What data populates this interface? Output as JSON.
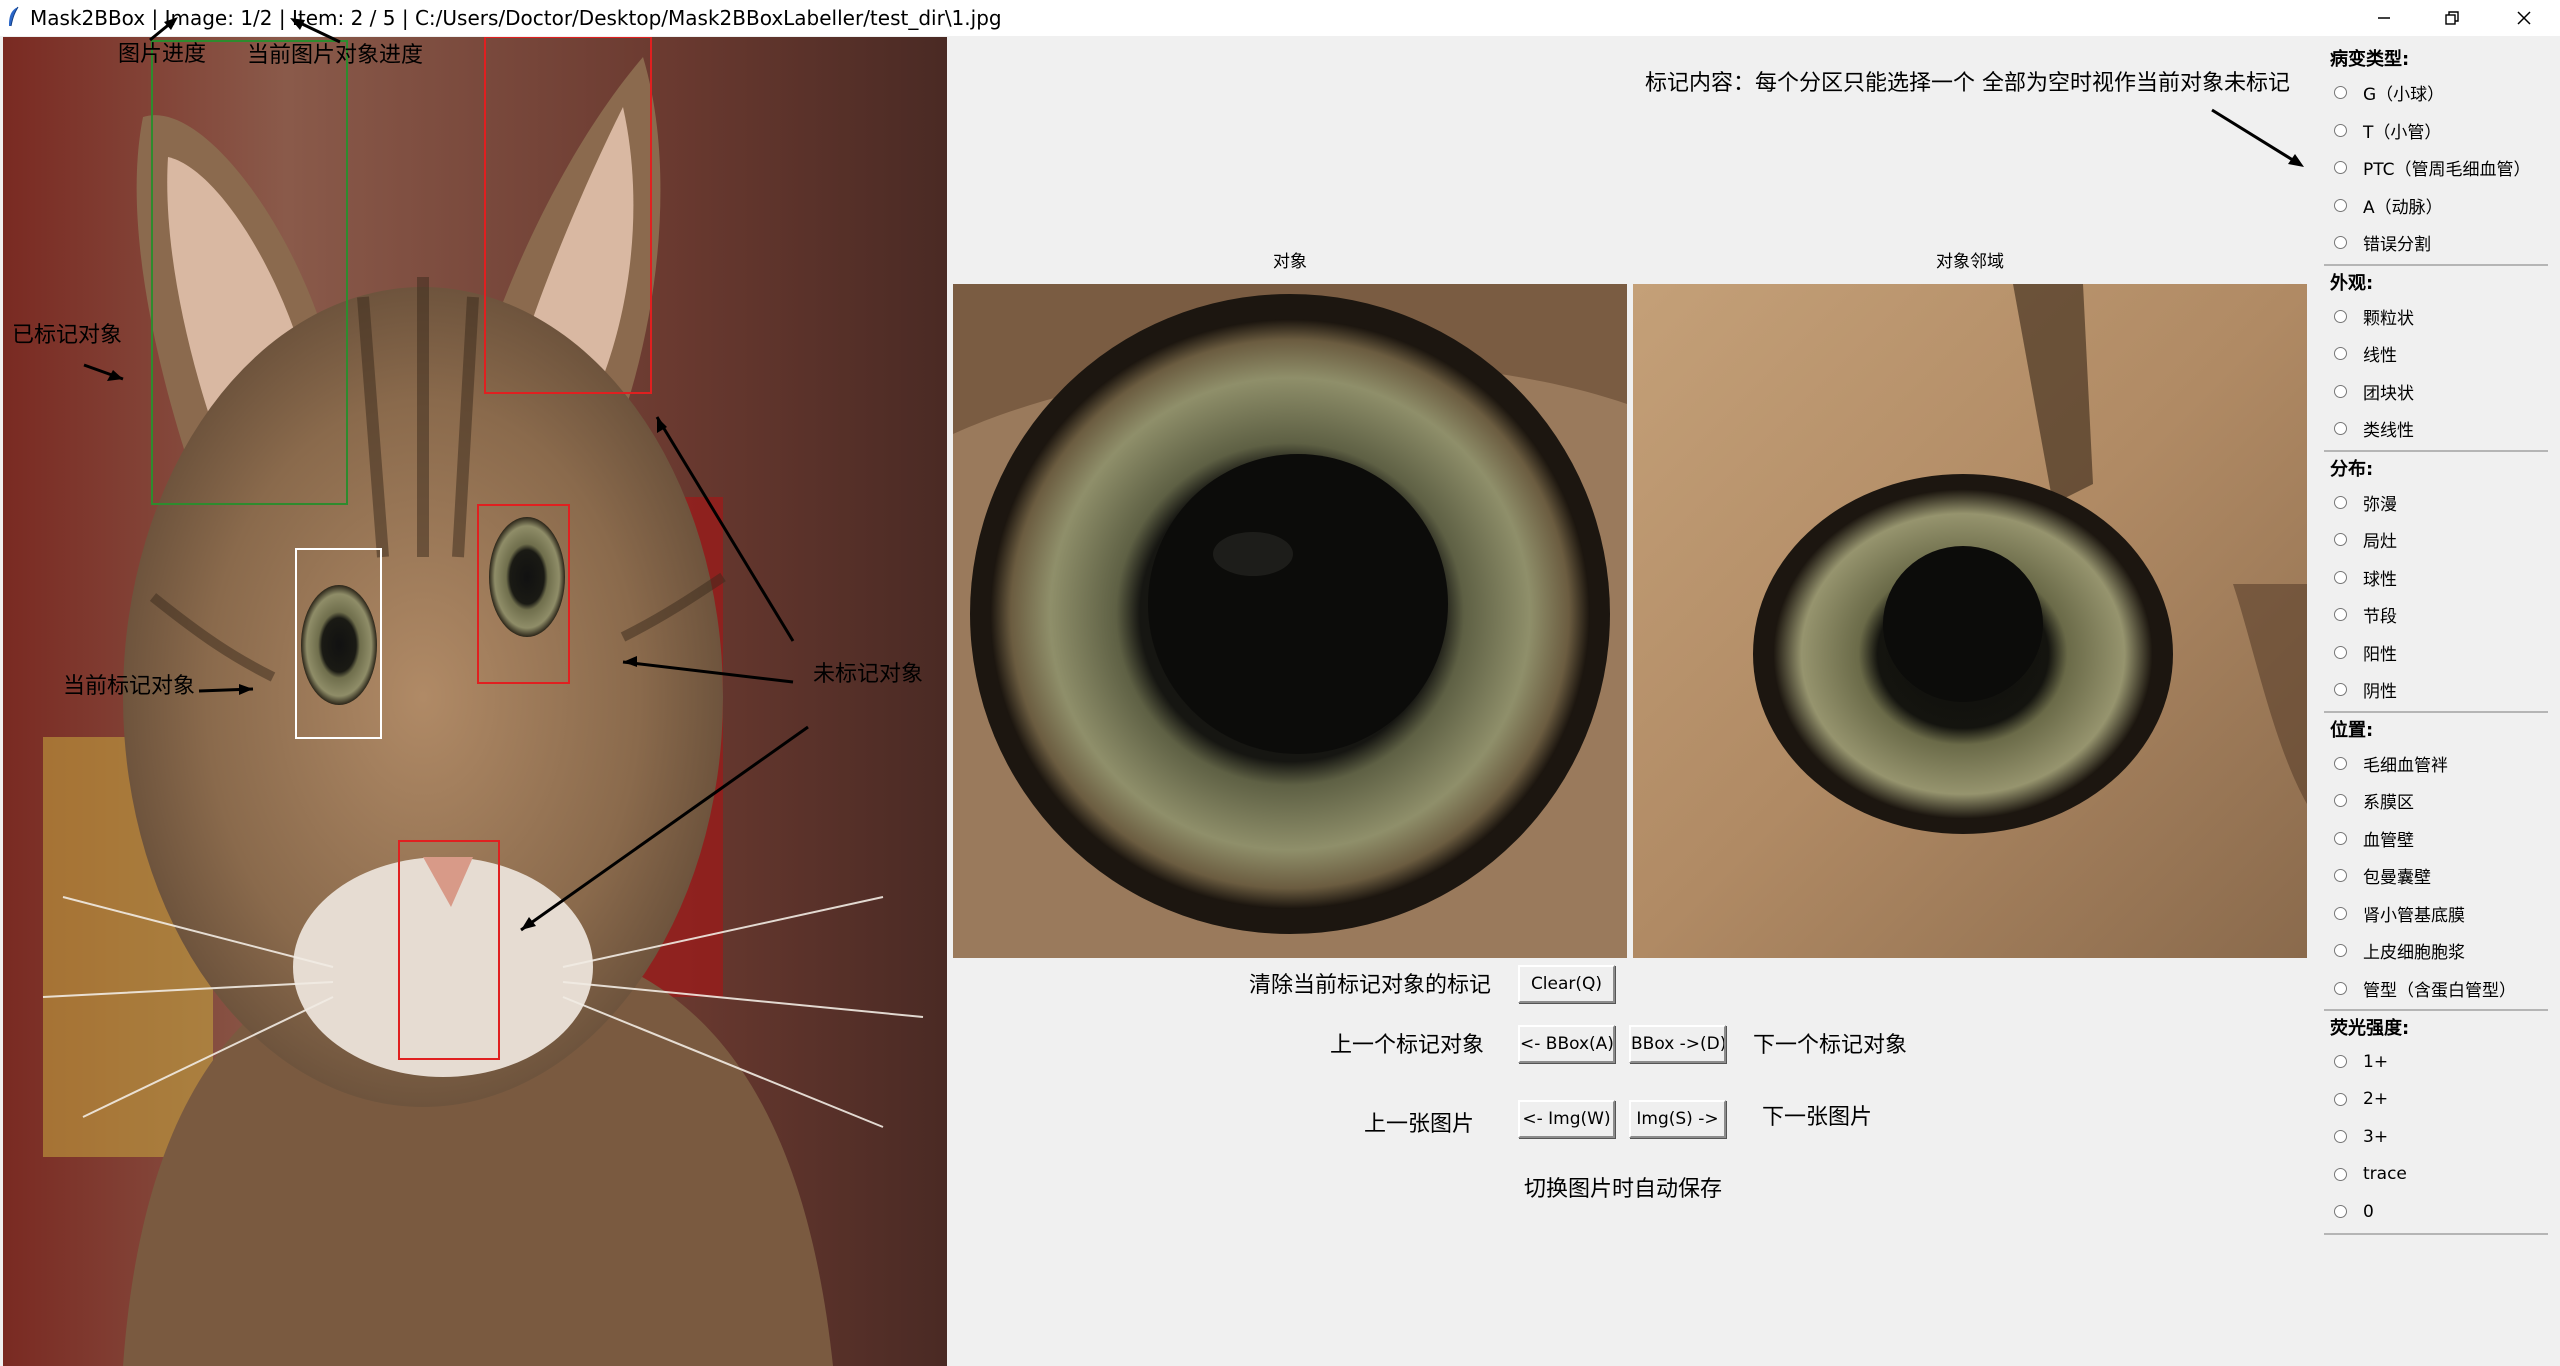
{
  "window": {
    "title": "Mask2BBox | Image: 1/2 | Item: 2 / 5 | C:/Users/Doctor/Desktop/Mask2BBoxLabeller/test_dir\\1.jpg",
    "minimize_icon": "minimize-icon",
    "restore_icon": "restore-icon",
    "close_icon": "close-icon"
  },
  "annotations": {
    "image_progress": "图片进度",
    "item_progress": "当前图片对象进度",
    "labeled": "已标记对象",
    "current": "当前标记对象",
    "unlabeled": "未标记对象",
    "label_content": "标记内容：每个分区只能选择一个 全部为空时视作当前对象未标记"
  },
  "preview": {
    "object_caption": "对象",
    "neighborhood_caption": "对象邻域"
  },
  "controls": {
    "clear_desc": "清除当前标记对象的标记",
    "clear_button": "Clear(Q)",
    "prev_bbox_desc": "上一个标记对象",
    "prev_bbox_button": "<- BBox(A)",
    "next_bbox_button": "BBox ->(D)",
    "next_bbox_desc": "下一个标记对象",
    "prev_img_desc": "上一张图片",
    "prev_img_button": "<- Img(W)",
    "next_img_button": "Img(S) ->",
    "next_img_desc": "下一张图片",
    "autosave_note": "切换图片时自动保存"
  },
  "sidebar": {
    "groups": [
      {
        "title": "病变类型:",
        "options": [
          "G（小球）",
          "T（小管）",
          "PTC（管周毛细血管）",
          "A（动脉）",
          "错误分割"
        ]
      },
      {
        "title": "外观:",
        "options": [
          "颗粒状",
          "线性",
          "团块状",
          "类线性"
        ]
      },
      {
        "title": "分布:",
        "options": [
          "弥漫",
          "局灶",
          "球性",
          "节段",
          "阳性",
          "阴性"
        ]
      },
      {
        "title": "位置:",
        "options": [
          "毛细血管袢",
          "系膜区",
          "血管壁",
          "包曼囊壁",
          "肾小管基底膜",
          "上皮细胞胞浆",
          "管型（含蛋白管型）"
        ]
      },
      {
        "title": "荧光强度:",
        "options": [
          "1+",
          "2+",
          "3+",
          "trace",
          "0"
        ]
      }
    ]
  },
  "colors": {
    "labeled_box": "#2e8b2e",
    "current_box": "#ffffff",
    "unlabeled_box": "#e02020"
  }
}
